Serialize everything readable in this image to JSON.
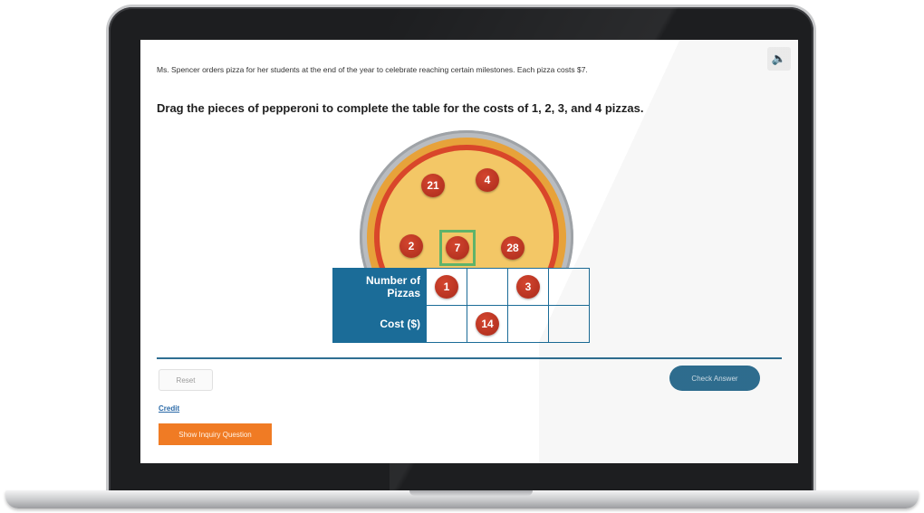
{
  "audio": {
    "icon": "speaker-icon",
    "glyph": "🔈"
  },
  "intro": {
    "text": "Ms. Spencer orders pizza for her students at the end of the year to celebrate reaching certain milestones. Each pizza costs $7."
  },
  "prompt": {
    "text": "Drag the pieces of pepperoni to complete the table for the costs of 1, 2, 3, and 4 pizzas."
  },
  "pizza": {
    "pepperoni": [
      {
        "label": "21"
      },
      {
        "label": "4"
      },
      {
        "label": "2"
      },
      {
        "label": "7"
      },
      {
        "label": "28"
      }
    ]
  },
  "table": {
    "row1_header": "Number of Pizzas",
    "row2_header": "Cost ($)",
    "row1_cells": [
      "1",
      "",
      "3",
      ""
    ],
    "row2_cells": [
      "",
      "14",
      "",
      ""
    ]
  },
  "controls": {
    "reset_label": "Reset",
    "check_label": "Check Answer",
    "credit_label": "Credit",
    "inquiry_label": "Show Inquiry Question"
  },
  "colors": {
    "table_header": "#1b6c98",
    "check_button": "#2f6f92",
    "inquiry_button": "#f07b24",
    "slot_highlight": "#5fb36a",
    "pepperoni": "#c0392b"
  }
}
